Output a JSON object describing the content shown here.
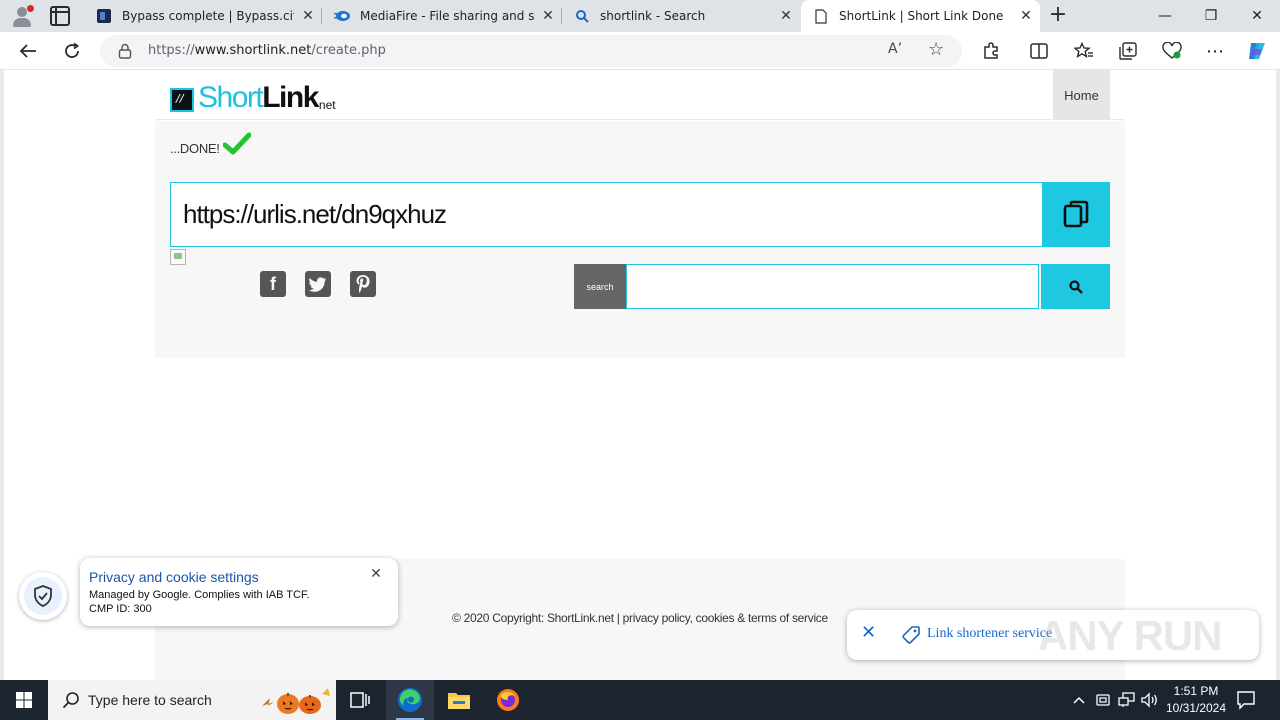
{
  "browser": {
    "tabs": [
      {
        "title": "Bypass complete | Bypass.city",
        "active": false
      },
      {
        "title": "MediaFire - File sharing and storage",
        "active": false
      },
      {
        "title": "shortlink - Search",
        "active": false
      },
      {
        "title": "ShortLink | Short Link Done",
        "active": true
      }
    ],
    "address": {
      "prefix": "https://",
      "host": "www.shortlink.net",
      "path": "/create.php"
    },
    "read_aloud_label": "A’"
  },
  "site": {
    "logo": {
      "part1": "Short",
      "part2": "Link",
      "suffix": "net"
    },
    "nav_home": "Home",
    "status_text": "...DONE!",
    "short_url": "https://urlis.net/dn9qxhuz",
    "search_label": "search",
    "search_value": "",
    "social": [
      "facebook",
      "twitter",
      "pinterest"
    ],
    "footer_text": "© 2020 Copyright: ShortLink.net | privacy policy, cookies & terms of service"
  },
  "cookie_popup": {
    "title": "Privacy and cookie settings",
    "line1": "Managed by Google. Complies with IAB TCF.",
    "line2": "CMP ID: 300"
  },
  "shortener_pill": {
    "label": "Link shortener service"
  },
  "watermark": "ANY RUN",
  "taskbar": {
    "search_placeholder": "Type here to search",
    "time": "1:51 PM",
    "date": "10/31/2024"
  },
  "colors": {
    "accent": "#1ec8e0",
    "check": "#22c52a",
    "link_blue": "#1a66c5"
  }
}
